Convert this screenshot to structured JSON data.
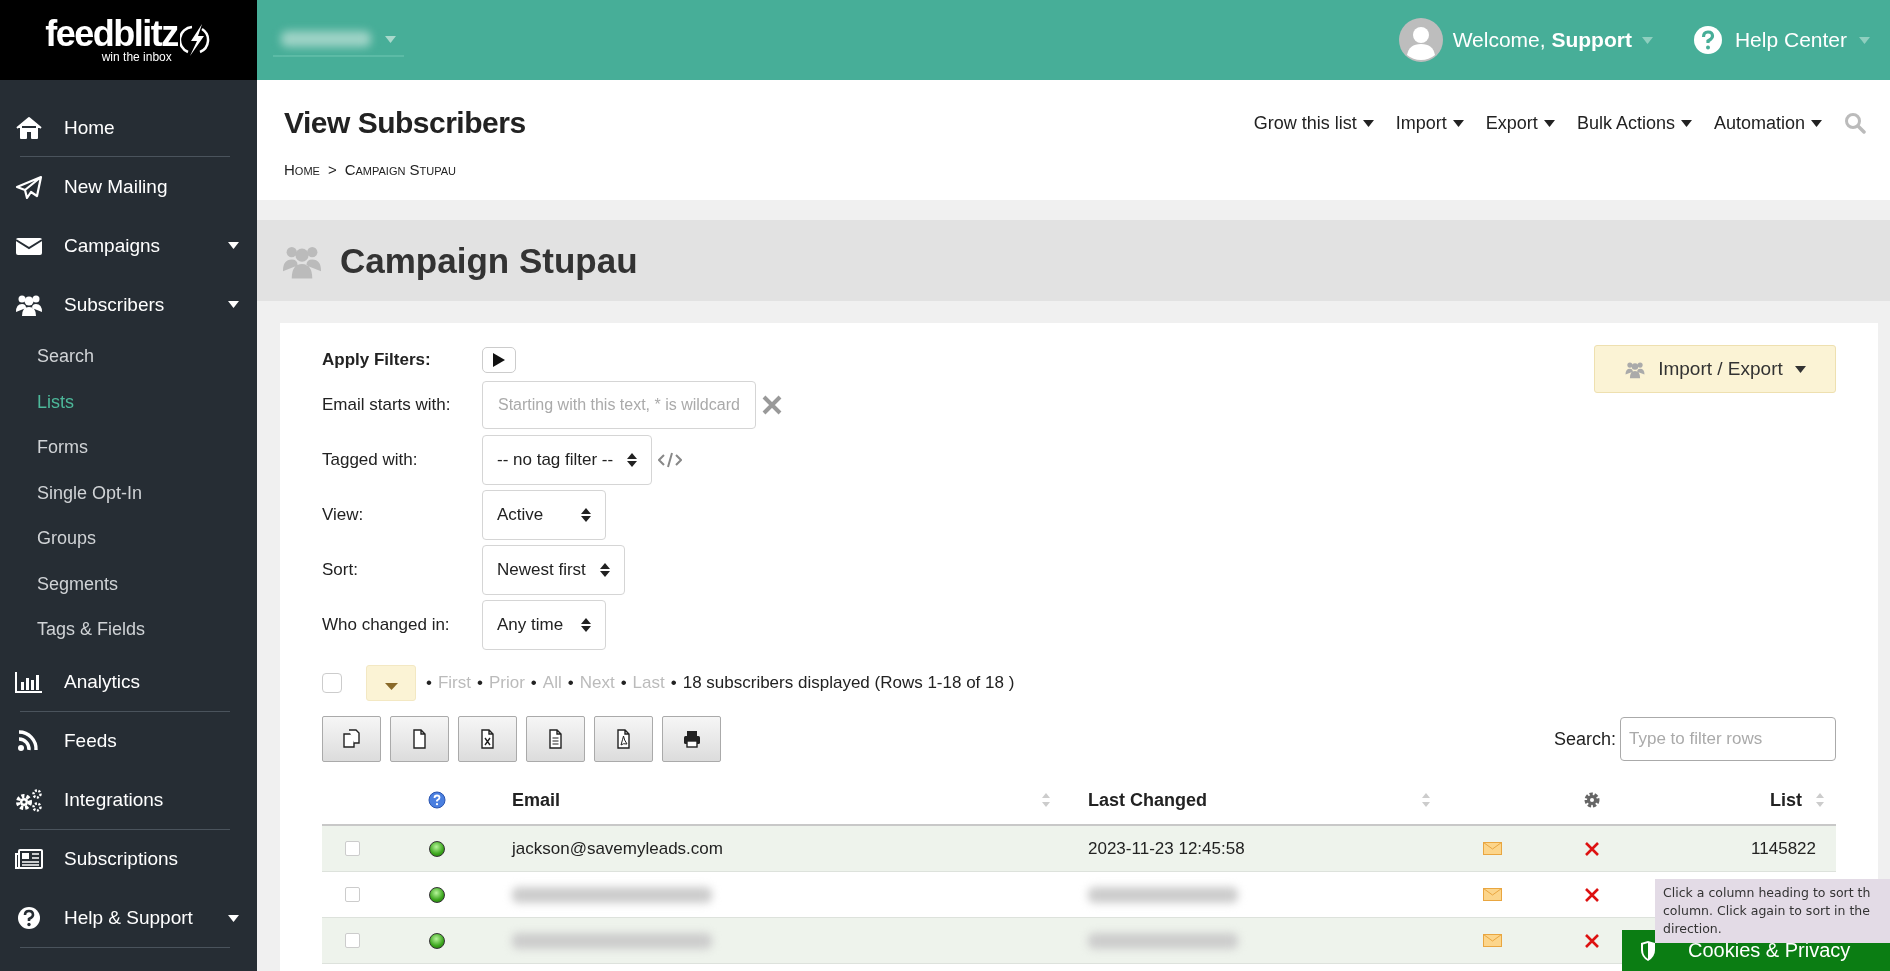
{
  "logo": {
    "name": "feedblitz",
    "tagline": "win the inbox"
  },
  "sidebar": {
    "items": [
      {
        "label": "Home",
        "has_submenu": false,
        "divider": true
      },
      {
        "label": "New Mailing",
        "has_submenu": false
      },
      {
        "label": "Campaigns",
        "has_submenu": true
      },
      {
        "label": "Subscribers",
        "has_submenu": true,
        "children": [
          {
            "label": "Search",
            "selected": false
          },
          {
            "label": "Lists",
            "selected": true
          },
          {
            "label": "Forms",
            "selected": false
          },
          {
            "label": "Single Opt-In",
            "selected": false
          },
          {
            "label": "Groups",
            "selected": false
          },
          {
            "label": "Segments",
            "selected": false
          },
          {
            "label": "Tags & Fields",
            "selected": false
          }
        ]
      },
      {
        "label": "Analytics",
        "has_submenu": false,
        "divider": true
      },
      {
        "label": "Feeds",
        "has_submenu": false
      },
      {
        "label": "Integrations",
        "has_submenu": false,
        "divider": true
      },
      {
        "label": "Subscriptions",
        "has_submenu": false
      },
      {
        "label": "Help & Support",
        "has_submenu": true,
        "divider": true
      }
    ]
  },
  "top_bar": {
    "welcome": "Welcome, **Support**",
    "help": "Help Center"
  },
  "header": {
    "title": "View Subscribers",
    "breadcrumb": {
      "items": [
        "Home",
        "Campaign Stupau"
      ],
      "separator": ">"
    },
    "menu": [
      "Grow this list",
      "Import",
      "Export",
      "Bulk Actions",
      "Automation"
    ]
  },
  "list_title": "Campaign Stupau",
  "import_export": "Import / Export",
  "filters": [
    {
      "kind": "apply",
      "label": "Apply Filters:"
    },
    {
      "kind": "text",
      "label": "Email starts with:",
      "placeholder": "Starting with this text, * is wildcard"
    },
    {
      "kind": "tag_select",
      "label": "Tagged with:",
      "value": "-- no tag filter --"
    },
    {
      "kind": "select",
      "label": "View:",
      "value": "Active"
    },
    {
      "kind": "select",
      "label": "Sort:",
      "value": "Newest first"
    },
    {
      "kind": "select",
      "label": "Who changed in:",
      "value": "Any time"
    }
  ],
  "pager": {
    "checked": false,
    "separator": "•",
    "links": [
      {
        "label": "First",
        "disabled": true
      },
      {
        "label": "Prior",
        "disabled": true
      },
      {
        "label": "All",
        "disabled": true
      },
      {
        "label": "Next",
        "disabled": true
      },
      {
        "label": "Last",
        "disabled": true
      }
    ],
    "summary": "18 subscribers displayed (Rows 1-18 of 18 )"
  },
  "export_buttons": [
    {
      "kind": "copy"
    },
    {
      "kind": "file"
    },
    {
      "kind": "excel"
    },
    {
      "kind": "text"
    },
    {
      "kind": "pdf"
    },
    {
      "kind": "print"
    }
  ],
  "search": {
    "label": "Search:",
    "placeholder": "Type to filter rows"
  },
  "table": {
    "columns": [
      {
        "kind": "select"
      },
      {
        "kind": "help"
      },
      {
        "kind": "text",
        "label": "Email"
      },
      {
        "kind": "text",
        "label": "Last Changed"
      },
      {
        "kind": "blank"
      },
      {
        "kind": "settings"
      },
      {
        "kind": "text",
        "label": "List"
      }
    ],
    "rows": [
      {
        "checked": false,
        "blurred": false,
        "email": "jackson@savemyleads.com",
        "last_changed": "2023-11-23 12:45:58",
        "list": "1145822"
      },
      {
        "checked": false,
        "blurred": true
      },
      {
        "checked": false,
        "blurred": true
      }
    ]
  },
  "tooltip": {
    "lines": [
      "Click a column heading to sort th",
      "column. Click again to sort in the",
      "direction."
    ]
  },
  "cookie_banner": {
    "label": "Cookies & Privacy"
  }
}
